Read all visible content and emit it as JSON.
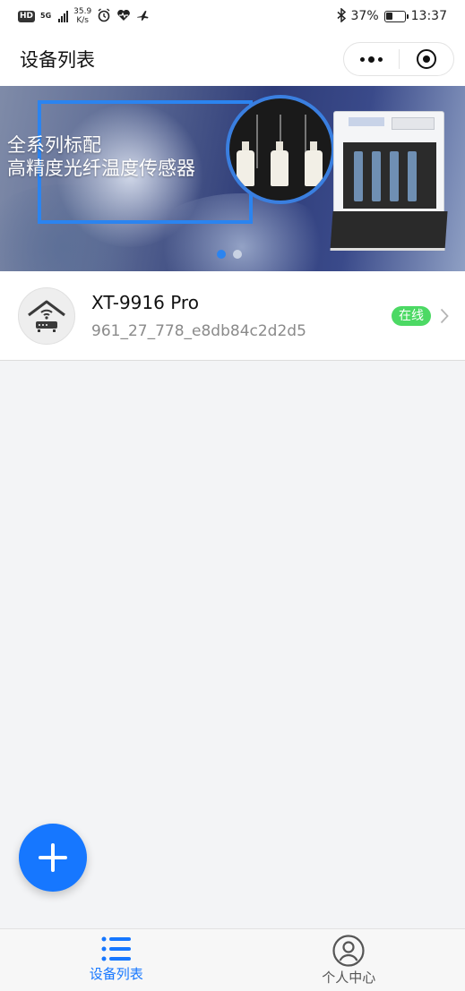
{
  "status_bar": {
    "hd": "HD",
    "network": "5G",
    "speed_value": "35.9",
    "speed_unit": "K/s",
    "battery": "37%",
    "battery_level": 0.37,
    "time": "13:37",
    "icons": [
      "alarm-icon",
      "heart-icon",
      "flight-icon",
      "bluetooth-icon",
      "battery-icon"
    ]
  },
  "navbar": {
    "title": "设备列表"
  },
  "banner": {
    "headline_line1": "全系列标配",
    "headline_line2": "高精度光纤温度传感器",
    "slide_count": 2,
    "active_slide": 0,
    "colors": {
      "frame": "#2b84f0",
      "dot_active": "#2b84f0",
      "dot_inactive": "#c9d2e3"
    }
  },
  "devices": [
    {
      "name": "XT-9916 Pro",
      "id": "961_27_778_e8db84c2d2d5",
      "status": "在线",
      "status_color": "#4cd964",
      "icon": "router-home-icon"
    }
  ],
  "fab": {
    "icon": "plus-icon",
    "color": "#1677ff"
  },
  "tabbar": {
    "tabs": [
      {
        "label": "设备列表",
        "icon": "list-icon",
        "active": true
      },
      {
        "label": "个人中心",
        "icon": "user-circle-icon",
        "active": false
      }
    ],
    "active_color": "#1677ff",
    "inactive_color": "#555555"
  }
}
